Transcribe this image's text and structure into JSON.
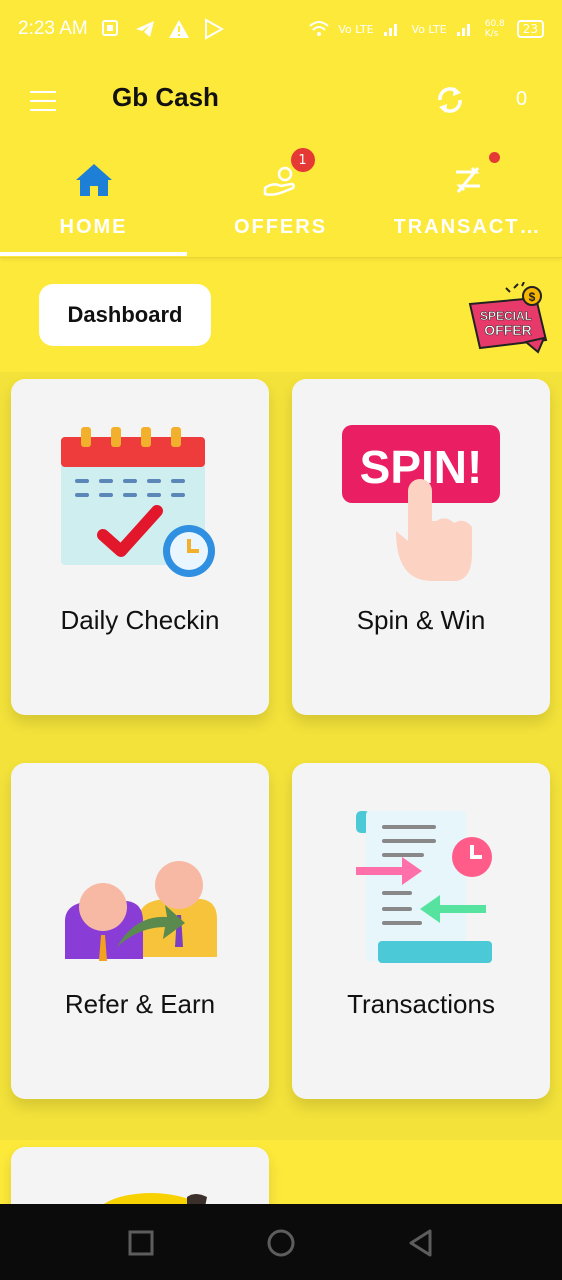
{
  "status_bar": {
    "time": "2:23 AM",
    "network_1": "Vo LTE",
    "network_2": "Vo LTE",
    "speed": "60.8 K/s",
    "battery": "23"
  },
  "app_bar": {
    "title": "Gb Cash",
    "coin_count": "0",
    "menu_icon": "hamburger-menu-icon",
    "refresh_icon": "refresh-icon"
  },
  "tabs": [
    {
      "label": "HOME",
      "icon": "home-icon",
      "active": true
    },
    {
      "label": "OFFERS",
      "icon": "offers-hand-icon",
      "badge": "1"
    },
    {
      "label": "TRANSACT…",
      "icon": "transactions-icon",
      "dot": true
    }
  ],
  "dashboard": {
    "label": "Dashboard",
    "special_offer_1": "SPECIAL",
    "special_offer_2": "OFFER"
  },
  "cards": [
    {
      "label": "Daily Checkin",
      "icon": "calendar-check-icon"
    },
    {
      "label": "Spin & Win",
      "icon": "spin-icon",
      "art_text": "SPIN!"
    },
    {
      "label": "Refer & Earn",
      "icon": "refer-people-icon"
    },
    {
      "label": "Transactions",
      "icon": "transactions-doc-icon"
    }
  ],
  "colors": {
    "background": "#fde93a",
    "card": "#f4f4f4",
    "accent_blue": "#1e7fd6",
    "badge_red": "#e53935",
    "spin_pink": "#e91e63"
  },
  "nav_bar": {
    "icons": [
      "recents-square-icon",
      "home-circle-icon",
      "back-triangle-icon"
    ]
  }
}
